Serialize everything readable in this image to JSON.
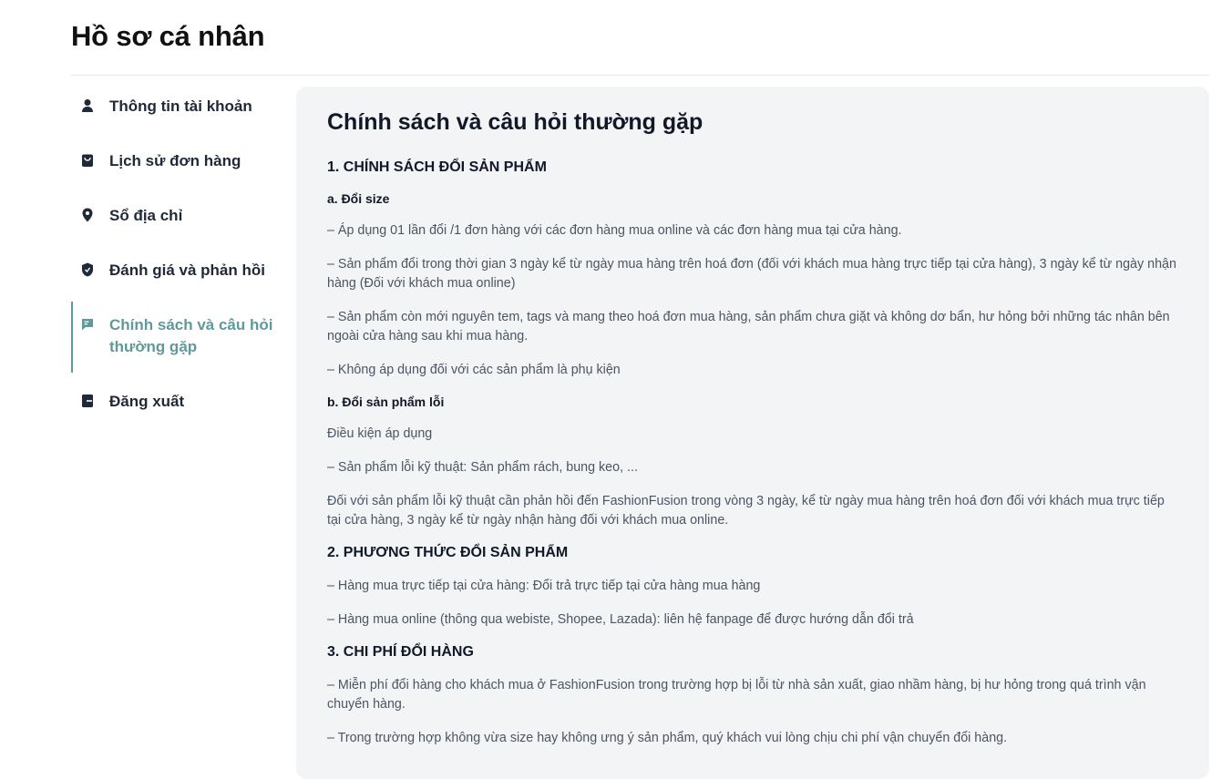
{
  "page": {
    "title": "Hồ sơ cá nhân"
  },
  "sidebar": {
    "items": [
      {
        "label": "Thông tin tài khoản",
        "icon": "user-icon"
      },
      {
        "label": "Lịch sử đơn hàng",
        "icon": "shopping-bag-icon"
      },
      {
        "label": "Sổ địa chỉ",
        "icon": "map-pin-icon"
      },
      {
        "label": "Đánh giá và phản hồi",
        "icon": "shield-icon"
      },
      {
        "label": "Chính sách và câu hỏi thường gặp",
        "icon": "message-icon",
        "active": true
      },
      {
        "label": "Đăng xuất",
        "icon": "logout-icon"
      }
    ]
  },
  "colors": {
    "accent": "#5f9a9b",
    "panel": "#f3f4f6"
  },
  "content": {
    "title": "Chính sách và câu hỏi thường gặp",
    "s1": {
      "heading": "1. CHÍNH SÁCH ĐỔI SẢN PHẨM",
      "a_heading": "a. Đổi size",
      "a_p1": "– Áp dụng 01 lần đổi /1 đơn hàng với các đơn hàng mua online và các đơn hàng mua tại cửa hàng.",
      "a_p2": "– Sản phẩm đổi trong thời gian 3 ngày kể từ ngày mua hàng trên hoá đơn (đối với khách mua hàng trực tiếp tại cửa hàng), 3 ngày kể từ ngày nhận hàng (Đối với khách mua online)",
      "a_p3": "– Sản phẩm còn mới nguyên tem, tags và mang theo hoá đơn mua hàng, sản phẩm chưa giặt và không dơ bẩn, hư hỏng bởi những tác nhân bên ngoài cửa hàng sau khi mua hàng.",
      "a_p4": "– Không áp dụng đối với các sản phẩm là phụ kiện",
      "b_heading": "b. Đổi sản phẩm lỗi",
      "b_p1": "Điều kiện áp dụng",
      "b_p2": "– Sản phẩm lỗi kỹ thuật: Sản phẩm rách, bung keo, ...",
      "b_p3": "Đối với sản phẩm lỗi kỹ thuật cần phản hồi đến FashionFusion trong vòng 3 ngày, kể từ ngày mua hàng trên hoá đơn đối với khách mua trực tiếp tại cửa hàng, 3 ngày kể từ ngày nhận hàng đối với khách mua online."
    },
    "s2": {
      "heading": "2. PHƯƠNG THỨC ĐỔI SẢN PHẨM",
      "p1": "– Hàng mua trực tiếp tại cửa hàng: Đổi trả trực tiếp tại cửa hàng mua hàng",
      "p2": "– Hàng mua online (thông qua webiste, Shopee, Lazada): liên hệ fanpage để được hướng dẫn đổi trả"
    },
    "s3": {
      "heading": "3. CHI PHÍ ĐỔI HÀNG",
      "p1": "– Miễn phí đổi hàng cho khách mua ở FashionFusion trong trường hợp bị lỗi từ nhà sản xuất, giao nhầm hàng, bị hư hỏng trong quá trình vận chuyển hàng.",
      "p2": "– Trong trường hợp không vừa size hay không ưng ý sản phẩm, quý khách vui lòng chịu chi phí vận chuyển đổi hàng."
    }
  }
}
